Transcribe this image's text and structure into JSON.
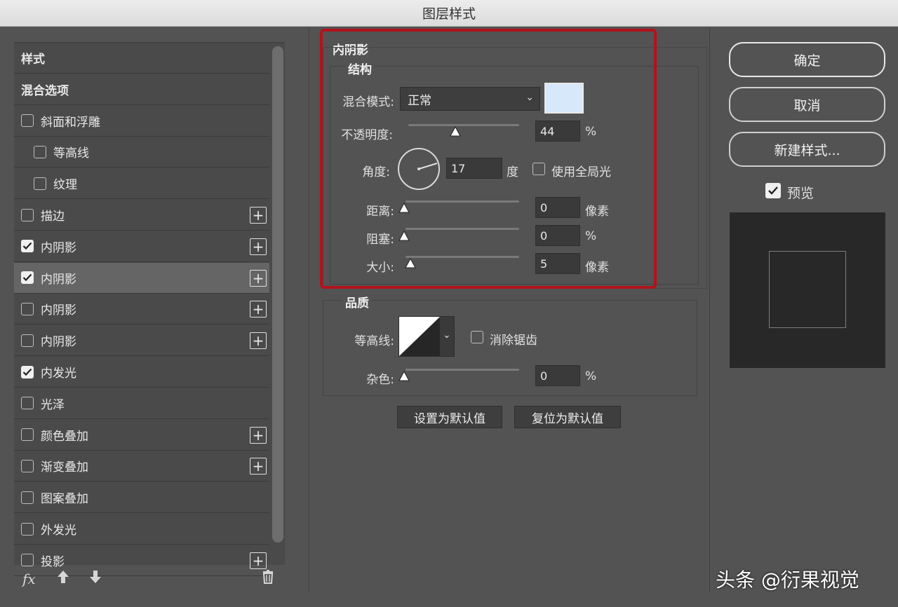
{
  "window": {
    "title": "图层样式"
  },
  "styles_list": {
    "items": [
      {
        "label": "样式",
        "checkbox": null,
        "checked": false,
        "add": false,
        "selected": false,
        "indent": false
      },
      {
        "label": "混合选项",
        "checkbox": null,
        "checked": false,
        "add": false,
        "selected": false,
        "indent": false
      },
      {
        "label": "斜面和浮雕",
        "checkbox": true,
        "checked": false,
        "add": false,
        "selected": false,
        "indent": false
      },
      {
        "label": "等高线",
        "checkbox": true,
        "checked": false,
        "add": false,
        "selected": false,
        "indent": true
      },
      {
        "label": "纹理",
        "checkbox": true,
        "checked": false,
        "add": false,
        "selected": false,
        "indent": true
      },
      {
        "label": "描边",
        "checkbox": true,
        "checked": false,
        "add": true,
        "selected": false,
        "indent": false
      },
      {
        "label": "内阴影",
        "checkbox": true,
        "checked": true,
        "add": true,
        "selected": false,
        "indent": false
      },
      {
        "label": "内阴影",
        "checkbox": true,
        "checked": true,
        "add": true,
        "selected": true,
        "indent": false
      },
      {
        "label": "内阴影",
        "checkbox": true,
        "checked": false,
        "add": true,
        "selected": false,
        "indent": false
      },
      {
        "label": "内阴影",
        "checkbox": true,
        "checked": false,
        "add": true,
        "selected": false,
        "indent": false
      },
      {
        "label": "内发光",
        "checkbox": true,
        "checked": true,
        "add": false,
        "selected": false,
        "indent": false
      },
      {
        "label": "光泽",
        "checkbox": true,
        "checked": false,
        "add": false,
        "selected": false,
        "indent": false
      },
      {
        "label": "颜色叠加",
        "checkbox": true,
        "checked": false,
        "add": true,
        "selected": false,
        "indent": false
      },
      {
        "label": "渐变叠加",
        "checkbox": true,
        "checked": false,
        "add": true,
        "selected": false,
        "indent": false
      },
      {
        "label": "图案叠加",
        "checkbox": true,
        "checked": false,
        "add": false,
        "selected": false,
        "indent": false
      },
      {
        "label": "外发光",
        "checkbox": true,
        "checked": false,
        "add": false,
        "selected": false,
        "indent": false
      },
      {
        "label": "投影",
        "checkbox": true,
        "checked": false,
        "add": true,
        "selected": false,
        "indent": false
      }
    ],
    "bottom": {
      "fx": "fx",
      "up_icon": "arrow-up-icon",
      "down_icon": "arrow-down-icon",
      "trash_icon": "trash-icon"
    }
  },
  "inner_shadow": {
    "section_title": "内阴影",
    "structure": {
      "title": "结构",
      "blend_mode_label": "混合模式:",
      "blend_mode_value": "正常",
      "shadow_color": "#d8e8fb",
      "opacity_label": "不透明度:",
      "opacity_value": "44",
      "opacity_unit": "%",
      "angle_label": "角度:",
      "angle_value": "17",
      "angle_unit": "度",
      "global_light_label": "使用全局光",
      "global_light_checked": false,
      "distance_label": "距离:",
      "distance_value": "0",
      "distance_unit": "像素",
      "choke_label": "阻塞:",
      "choke_value": "0",
      "choke_unit": "%",
      "size_label": "大小:",
      "size_value": "5",
      "size_unit": "像素"
    },
    "quality": {
      "title": "品质",
      "contour_label": "等高线:",
      "anti_alias_label": "消除锯齿",
      "anti_alias_checked": false,
      "noise_label": "杂色:",
      "noise_value": "0",
      "noise_unit": "%"
    },
    "set_default_label": "设置为默认值",
    "reset_default_label": "复位为默认值"
  },
  "actions": {
    "ok_label": "确定",
    "cancel_label": "取消",
    "new_style_label": "新建样式...",
    "preview_label": "预览",
    "preview_checked": true
  },
  "watermark": "头条 @衍果视觉"
}
